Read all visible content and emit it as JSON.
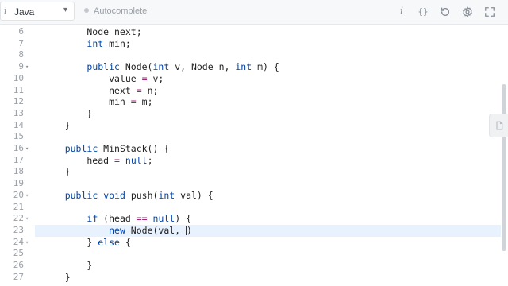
{
  "toolbar": {
    "language": "Java",
    "info_glyph": "i",
    "autocomplete_label": "Autocomplete",
    "icons": [
      "info-icon",
      "braces-icon",
      "reset-icon",
      "settings-icon",
      "expand-icon"
    ],
    "info_text": "i",
    "braces_text": "{}"
  },
  "editor": {
    "active_line": 23,
    "lines": [
      {
        "n": "6",
        "fold": "",
        "text": "        Node next;"
      },
      {
        "n": "7",
        "fold": "",
        "text": "        int min;"
      },
      {
        "n": "8",
        "fold": "",
        "text": ""
      },
      {
        "n": "9",
        "fold": "▾",
        "text": "        public Node(int v, Node n, int m) {"
      },
      {
        "n": "10",
        "fold": "",
        "text": "            value = v;"
      },
      {
        "n": "11",
        "fold": "",
        "text": "            next = n;"
      },
      {
        "n": "12",
        "fold": "",
        "text": "            min = m;"
      },
      {
        "n": "13",
        "fold": "",
        "text": "        }"
      },
      {
        "n": "14",
        "fold": "",
        "text": "    }"
      },
      {
        "n": "15",
        "fold": "",
        "text": ""
      },
      {
        "n": "16",
        "fold": "▾",
        "text": "    public MinStack() {"
      },
      {
        "n": "17",
        "fold": "",
        "text": "        head = null;"
      },
      {
        "n": "18",
        "fold": "",
        "text": "    }"
      },
      {
        "n": "19",
        "fold": "",
        "text": ""
      },
      {
        "n": "20",
        "fold": "▾",
        "text": "    public void push(int val) {"
      },
      {
        "n": "21",
        "fold": "",
        "text": ""
      },
      {
        "n": "22",
        "fold": "▾",
        "text": "        if (head == null) {"
      },
      {
        "n": "23",
        "fold": "",
        "text": "            new Node(val, )"
      },
      {
        "n": "24",
        "fold": "▾",
        "text": "        } else {"
      },
      {
        "n": "25",
        "fold": "",
        "text": ""
      },
      {
        "n": "26",
        "fold": "",
        "text": "        }"
      },
      {
        "n": "27",
        "fold": "",
        "text": "    }"
      }
    ]
  },
  "colors": {
    "keyword": "#0044aa",
    "operator": "#a6237a",
    "active_line_bg": "#e8f2ff",
    "gutter_text": "#9aa0a6"
  }
}
